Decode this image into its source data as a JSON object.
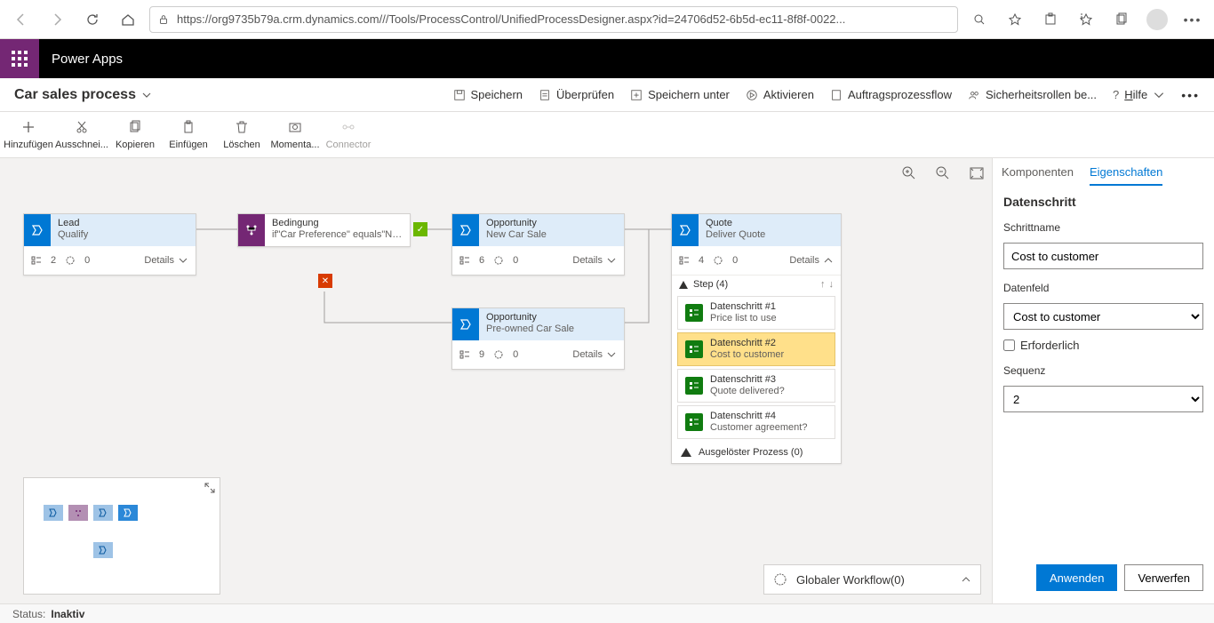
{
  "browser": {
    "url": "https://org9735b79a.crm.dynamics.com///Tools/ProcessControl/UnifiedProcessDesigner.aspx?id=24706d52-6b5d-ec11-8f8f-0022..."
  },
  "app": {
    "title": "Power Apps"
  },
  "header": {
    "process_name": "Car sales process",
    "cmds": {
      "save": "Speichern",
      "validate": "Überprüfen",
      "save_as": "Speichern unter",
      "activate": "Aktivieren",
      "order_flow": "Auftragsprozessflow",
      "security": "Sicherheitsrollen be...",
      "help": "Hilfe"
    }
  },
  "toolbar": {
    "add": "Hinzufügen",
    "cut": "Ausschnei...",
    "copy": "Kopieren",
    "paste": "Einfügen",
    "delete": "Löschen",
    "snapshot": "Momenta...",
    "connector": "Connector"
  },
  "stages": {
    "lead": {
      "entity": "Lead",
      "name": "Qualify",
      "steps": "2",
      "triggers": "0",
      "details": "Details"
    },
    "cond": {
      "label": "Bedingung",
      "expr": "if\"Car Preference\" equals\"New C..."
    },
    "opp_new": {
      "entity": "Opportunity",
      "name": "New Car Sale",
      "steps": "6",
      "triggers": "0",
      "details": "Details"
    },
    "opp_pre": {
      "entity": "Opportunity",
      "name": "Pre-owned Car Sale",
      "steps": "9",
      "triggers": "0",
      "details": "Details"
    },
    "quote": {
      "entity": "Quote",
      "name": "Deliver Quote",
      "steps_count": "4",
      "triggers": "0",
      "details": "Details",
      "step_header": "Step (4)",
      "steps": [
        {
          "title": "Datenschritt #1",
          "sub": "Price list to use"
        },
        {
          "title": "Datenschritt #2",
          "sub": "Cost to customer"
        },
        {
          "title": "Datenschritt #3",
          "sub": "Quote delivered?"
        },
        {
          "title": "Datenschritt #4",
          "sub": "Customer agreement?"
        }
      ],
      "trigger_row": "Ausgelöster Prozess (0)"
    }
  },
  "global_workflow": "Globaler Workflow(0)",
  "panel": {
    "tab_components": "Komponenten",
    "tab_properties": "Eigenschaften",
    "section": "Datenschritt",
    "stepname_label": "Schrittname",
    "stepname_value": "Cost to customer",
    "datafield_label": "Datenfeld",
    "datafield_value": "Cost to customer",
    "required_label": "Erforderlich",
    "sequence_label": "Sequenz",
    "sequence_value": "2",
    "apply": "Anwenden",
    "discard": "Verwerfen"
  },
  "status": {
    "label": "Status:",
    "value": "Inaktiv"
  }
}
